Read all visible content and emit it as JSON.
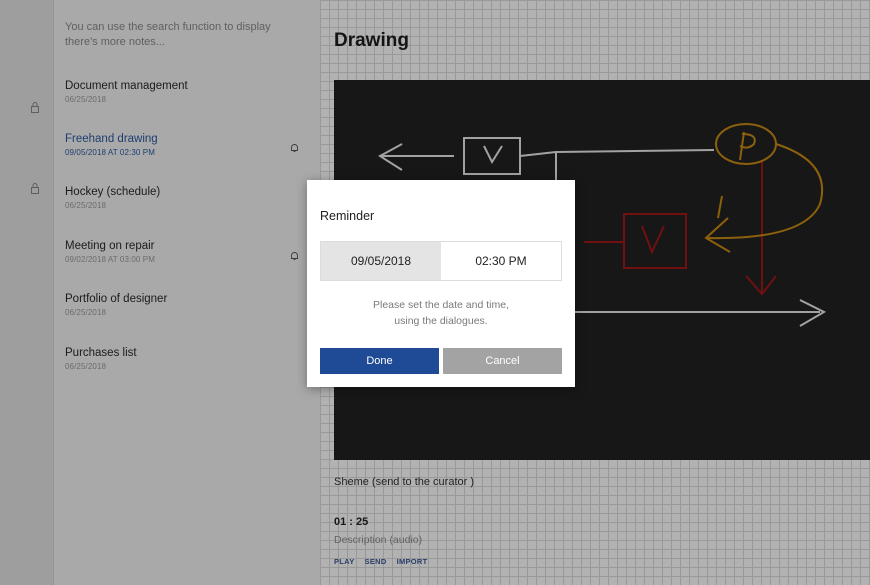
{
  "sidebar": {
    "hint": "You can use the search function to display there's more notes...",
    "notes": [
      {
        "title": "Document management",
        "date": "06/25/2018",
        "locked": true,
        "reminder": false
      },
      {
        "title": "Freehand drawing",
        "date": "09/05/2018 AT 02:30 PM",
        "locked": false,
        "reminder": true,
        "active": true
      },
      {
        "title": "Hockey (schedule)",
        "date": "06/25/2018",
        "locked": true,
        "reminder": false
      },
      {
        "title": "Meeting on repair",
        "date": "09/02/2018 AT 03:00 PM",
        "locked": false,
        "reminder": true
      },
      {
        "title": "Portfolio of designer",
        "date": "06/25/2018",
        "locked": false,
        "reminder": false
      },
      {
        "title": "Purchases list",
        "date": "06/25/2018",
        "locked": false,
        "reminder": false
      }
    ]
  },
  "main": {
    "title": "Drawing",
    "caption": "Sheme (send to the curator )",
    "audio_time": "01 : 25",
    "audio_description": "Description (audio)",
    "actions": [
      "PLAY",
      "SEND",
      "IMPORT"
    ]
  },
  "dialog": {
    "title": "Reminder",
    "date_value": "09/05/2018",
    "time_value": "02:30 PM",
    "message_line1": "Please set the date and time,",
    "message_line2": "using the dialogues.",
    "done_label": "Done",
    "cancel_label": "Cancel"
  },
  "icons": {
    "lock": "lock-icon",
    "bell": "bell-icon"
  },
  "colors": {
    "accent": "#1f4a96",
    "active_text": "#2c5aa0",
    "board": "#222222",
    "stroke_white": "#e8e8e8",
    "stroke_red": "#a11717",
    "stroke_orange": "#c98a13"
  }
}
